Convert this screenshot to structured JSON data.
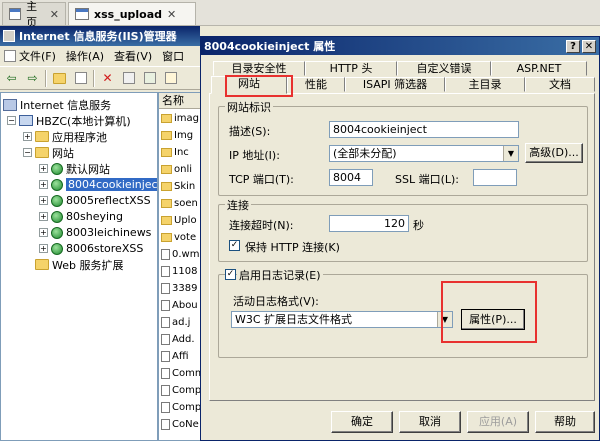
{
  "browser_tabs": [
    {
      "label": "主页",
      "close": "✕"
    },
    {
      "label": "xss_upload",
      "close": "✕"
    }
  ],
  "iis": {
    "title": "Internet 信息服务(IIS)管理器",
    "menu": [
      "文件(F)",
      "操作(A)",
      "查看(V)",
      "窗口"
    ],
    "tree": [
      {
        "label": "Internet 信息服务",
        "level": 0
      },
      {
        "label": "HBZC(本地计算机)",
        "level": 1
      },
      {
        "label": "应用程序池",
        "level": 2
      },
      {
        "label": "网站",
        "level": 2
      },
      {
        "label": "默认网站",
        "level": 3
      },
      {
        "label": "8004cookieinject",
        "level": 3
      },
      {
        "label": "8005reflectXSS",
        "level": 3
      },
      {
        "label": "80sheying",
        "level": 3
      },
      {
        "label": "8003leichinews",
        "level": 3
      },
      {
        "label": "8006storeXSS",
        "level": 3
      },
      {
        "label": "Web 服务扩展",
        "level": 2
      }
    ],
    "list_header": "名称",
    "list_items": [
      "imag",
      "Img",
      "Inc",
      "onli",
      "Skin",
      "soen",
      "Uplo",
      "vote",
      "0.wm",
      "1108",
      "3389",
      "Abou",
      "ad.j",
      "Add.",
      "Affi",
      "Comm",
      "Comp",
      "Comp",
      "CoNe"
    ]
  },
  "dialog": {
    "title": "8004cookieinject 属性",
    "help_btn": "?",
    "close_btn": "✕",
    "tabs_row1": [
      "目录安全性",
      "HTTP 头",
      "自定义错误",
      "ASP.NET"
    ],
    "tabs_row2": [
      "网站",
      "性能",
      "ISAPI 筛选器",
      "主目录",
      "文档"
    ],
    "site_ident": {
      "legend": "网站标识",
      "desc_label": "描述(S):",
      "desc_value": "8004cookieinject",
      "ip_label": "IP 地址(I):",
      "ip_value": "(全部未分配)",
      "advanced_btn": "高级(D)...",
      "tcp_label": "TCP 端口(T):",
      "tcp_value": "8004",
      "ssl_label": "SSL 端口(L):",
      "ssl_value": ""
    },
    "connection": {
      "legend": "连接",
      "timeout_label": "连接超时(N):",
      "timeout_value": "120",
      "timeout_unit": "秒",
      "keepalive_label": "保持 HTTP 连接(K)",
      "keepalive_checked": true
    },
    "logging": {
      "legend": "启用日志记录(E)",
      "enabled": true,
      "format_label": "活动日志格式(V):",
      "format_value": "W3C 扩展日志文件格式",
      "props_btn": "属性(P)..."
    },
    "buttons": {
      "ok": "确定",
      "cancel": "取消",
      "apply": "应用(A)",
      "help": "帮助"
    },
    "check_mark": "✓",
    "combo_arrow": "▼"
  },
  "colors": {
    "title_bar": "#0a246a",
    "highlight": "#e8312f",
    "selection": "#316ac5"
  }
}
